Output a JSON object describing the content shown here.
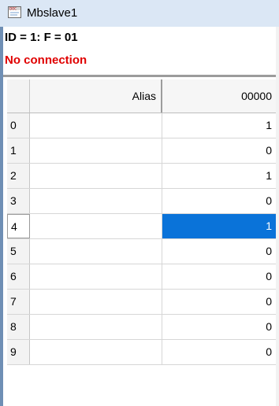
{
  "window": {
    "title": "Mbslave1",
    "icon": "app-document-icon"
  },
  "status": {
    "id_line": "ID = 1: F = 01",
    "connection": "No connection",
    "connection_color": "#e00000"
  },
  "grid": {
    "columns": {
      "alias": "Alias",
      "value": "00000"
    },
    "rows": [
      {
        "index": "0",
        "alias": "",
        "value": "1"
      },
      {
        "index": "1",
        "alias": "",
        "value": "0"
      },
      {
        "index": "2",
        "alias": "",
        "value": "1"
      },
      {
        "index": "3",
        "alias": "",
        "value": "0"
      },
      {
        "index": "4",
        "alias": "",
        "value": "1"
      },
      {
        "index": "5",
        "alias": "",
        "value": "0"
      },
      {
        "index": "6",
        "alias": "",
        "value": "0"
      },
      {
        "index": "7",
        "alias": "",
        "value": "0"
      },
      {
        "index": "8",
        "alias": "",
        "value": "0"
      },
      {
        "index": "9",
        "alias": "",
        "value": "0"
      }
    ],
    "selected_row": "4",
    "selection_color": "#0a73d9"
  }
}
